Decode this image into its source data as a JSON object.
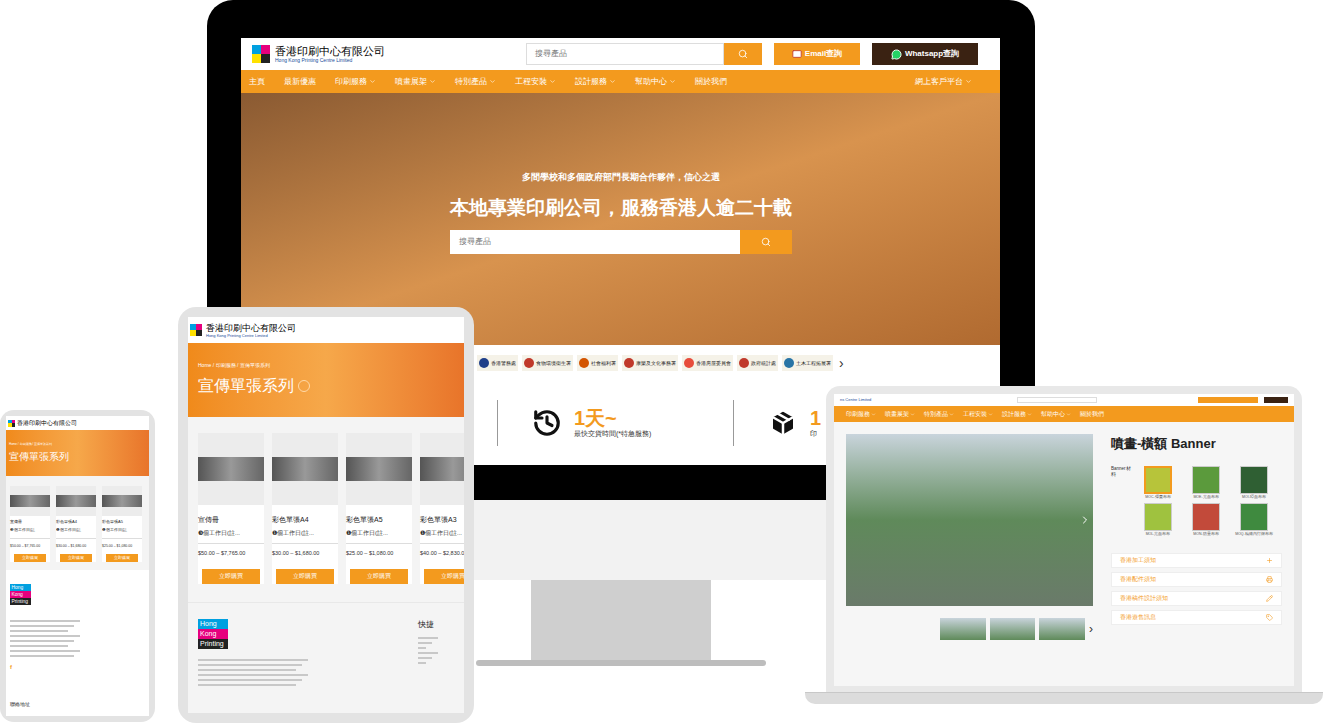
{
  "monitor": {
    "header": {
      "company": "香港印刷中心有限公司",
      "company_en": "Hong Kong Printing Centre Limited",
      "search_placeholder": "搜尋產品",
      "email_button": "Email查詢",
      "whatsapp_button": "Whatsapp查詢"
    },
    "nav": [
      {
        "label": "主頁",
        "dropdown": false
      },
      {
        "label": "最新優惠",
        "dropdown": false
      },
      {
        "label": "印刷服務",
        "dropdown": true
      },
      {
        "label": "噴畫展架",
        "dropdown": true
      },
      {
        "label": "特別產品",
        "dropdown": true
      },
      {
        "label": "工程安裝",
        "dropdown": true
      },
      {
        "label": "設計服務",
        "dropdown": true
      },
      {
        "label": "幫助中心",
        "dropdown": true
      },
      {
        "label": "關於我們",
        "dropdown": false
      }
    ],
    "nav_right": {
      "label": "網上客戶平台",
      "dropdown": true
    },
    "hero": {
      "subtitle": "多間學校和多個政府部門長期合作夥伴，信心之選",
      "title": "本地專業印刷公司，服務香港人逾二十載",
      "search_placeholder": "搜尋產品"
    },
    "partners": [
      {
        "name": "香港警務處",
        "color": "#1f3f8a"
      },
      {
        "name": "食物環境衞生署",
        "color": "#c0392b"
      },
      {
        "name": "社會福利署",
        "color": "#d35400"
      },
      {
        "name": "康樂及文化事務署",
        "color": "#c0392b"
      },
      {
        "name": "香港房屋委員會",
        "color": "#e74c3c"
      },
      {
        "name": "政府統計處",
        "color": "#c0392b"
      },
      {
        "name": "土木工程拓展署",
        "color": "#2874a6"
      }
    ],
    "partners_next": "›",
    "stats": [
      {
        "value": "1天~",
        "label": "最快交貨時間(*特急服務)"
      },
      {
        "value": "1",
        "label": "印"
      }
    ]
  },
  "logo": {
    "words": [
      "Hong",
      "Kong",
      "Printing"
    ]
  },
  "tablet": {
    "company": "香港印刷中心有限公司",
    "company_en": "Hong Kong Printing Centre Limited",
    "breadcrumb": "Home / 印刷服務 / 宣傳單張系列",
    "title": "宣傳單張系列",
    "products": [
      {
        "name": "宣傳冊",
        "note": "❸個工作日(註...",
        "price": "$50.00 – $7,765.00",
        "button": "立即購買"
      },
      {
        "name": "彩色單張A4",
        "note": "❶個工作日(註...",
        "price": "$30.00 – $1,680.00",
        "button": "立即購買"
      },
      {
        "name": "彩色單張A5",
        "note": "❶個工作日(註...",
        "price": "$25.00 – $1,080.00",
        "button": "立即購買"
      },
      {
        "name": "彩色單張A3",
        "note": "❶個工作日(註...",
        "price": "$40.00 – $2,830.0",
        "button": "立即購買"
      }
    ],
    "footer_heading": "快捷"
  },
  "phone": {
    "company": "香港印刷中心有限公司",
    "breadcrumb": "Home / 印刷服務 / 宣傳單張系列",
    "title": "宣傳單張系列",
    "products": [
      {
        "name": "宣傳冊",
        "note": "❸個工作日(註",
        "price": "$50.00 – $7,765.00",
        "button": "立即購買"
      },
      {
        "name": "彩色單張A4",
        "note": "❶個工作日(註",
        "price": "$30.00 – $1,680.00",
        "button": "立即購買"
      },
      {
        "name": "彩色單張A5",
        "note": "❶個工作日(註",
        "price": "$25.00 – $1,080.00",
        "button": "立即購買"
      }
    ],
    "social": "f",
    "footer_heading": "聯絡地址"
  },
  "laptop": {
    "top_text": "ns Centre Limited",
    "nav": [
      {
        "label": "印刷服務",
        "dropdown": true
      },
      {
        "label": "噴畫展架",
        "dropdown": true
      },
      {
        "label": "特別產品",
        "dropdown": true
      },
      {
        "label": "工程安裝",
        "dropdown": true
      },
      {
        "label": "設計服務",
        "dropdown": true
      },
      {
        "label": "幫助中心",
        "dropdown": true
      },
      {
        "label": "關於我們",
        "dropdown": false
      }
    ],
    "gallery_next": "›",
    "title": "噴畫-橫額 Banner",
    "material_label": "Banner材料",
    "materials": [
      {
        "name": "MOC-彈畫布布",
        "color": "#b7c43a",
        "selected": true
      },
      {
        "name": "MOE-光面布布",
        "color": "#5b9a3c",
        "selected": false
      },
      {
        "name": "MOI-啞面布布",
        "color": "#2f5f33",
        "selected": false
      },
      {
        "name": "MOL-光面布布",
        "color": "#9fc23f",
        "selected": false
      },
      {
        "name": "MON-防量布布",
        "color": "#c24a3a",
        "selected": false
      },
      {
        "name": "MOQ-精緻內打燈布布",
        "color": "#3f8a3f",
        "selected": false
      }
    ],
    "accordions": [
      {
        "label": "香港加工須知",
        "kind": "plus"
      },
      {
        "label": "香港配件須知",
        "kind": "printer"
      },
      {
        "label": "香港稿件設計須知",
        "kind": "pencil"
      },
      {
        "label": "香港遊售訊息",
        "kind": "tag"
      }
    ]
  }
}
